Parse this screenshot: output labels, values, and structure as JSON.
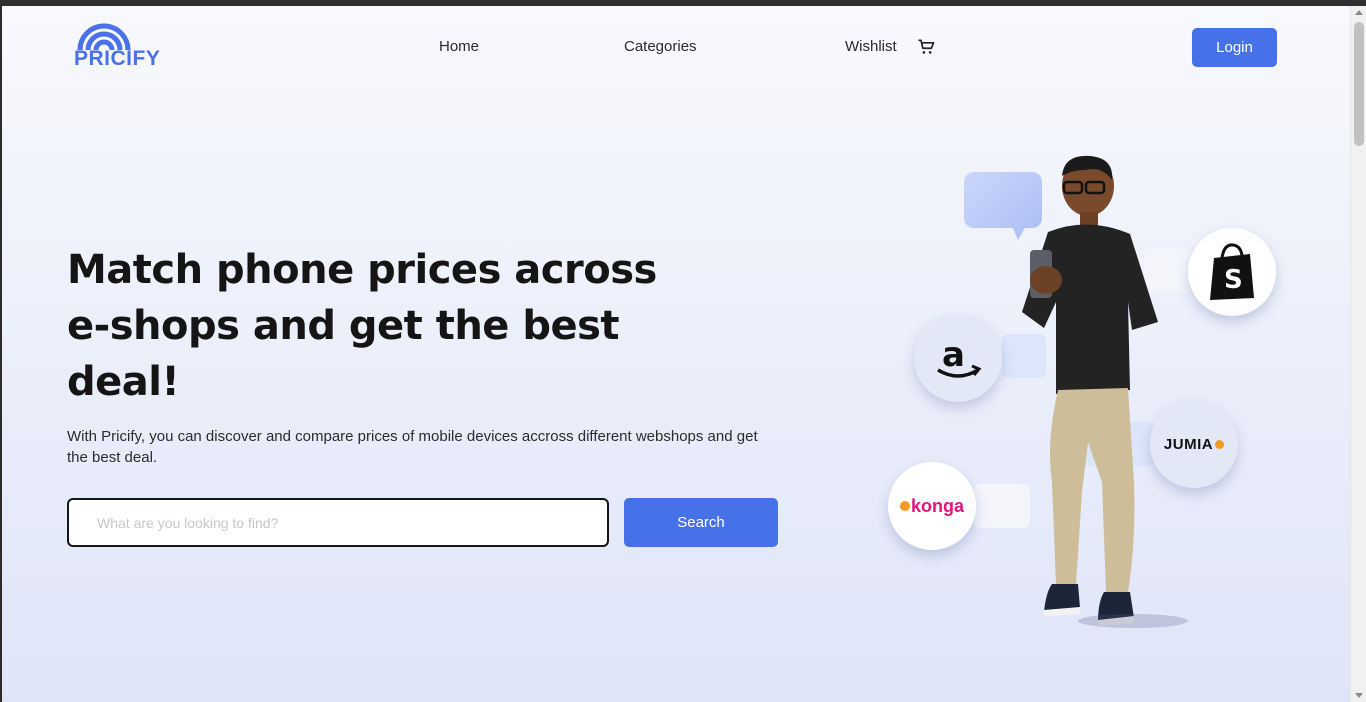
{
  "brand": {
    "name": "PRICIFY",
    "color": "#4a71e8"
  },
  "nav": {
    "home": "Home",
    "categories": "Categories",
    "wishlist": "Wishlist",
    "cart_icon": "cart-icon",
    "login": "Login"
  },
  "hero": {
    "title": "Match phone prices across e-shops and get the best deal!",
    "subtitle": "With Pricify, you can discover and compare prices of mobile devices accross different webshops and get the best deal.",
    "search_placeholder": "What are you looking to find?",
    "search_value": "",
    "search_button": "Search"
  },
  "shops": {
    "shopify_icon": "shopify-bag-icon",
    "amazon_icon": "amazon-logo-icon",
    "jumia": "JUMIA",
    "konga": "konga"
  },
  "colors": {
    "accent": "#4771e9",
    "background": "#eef1fb"
  }
}
